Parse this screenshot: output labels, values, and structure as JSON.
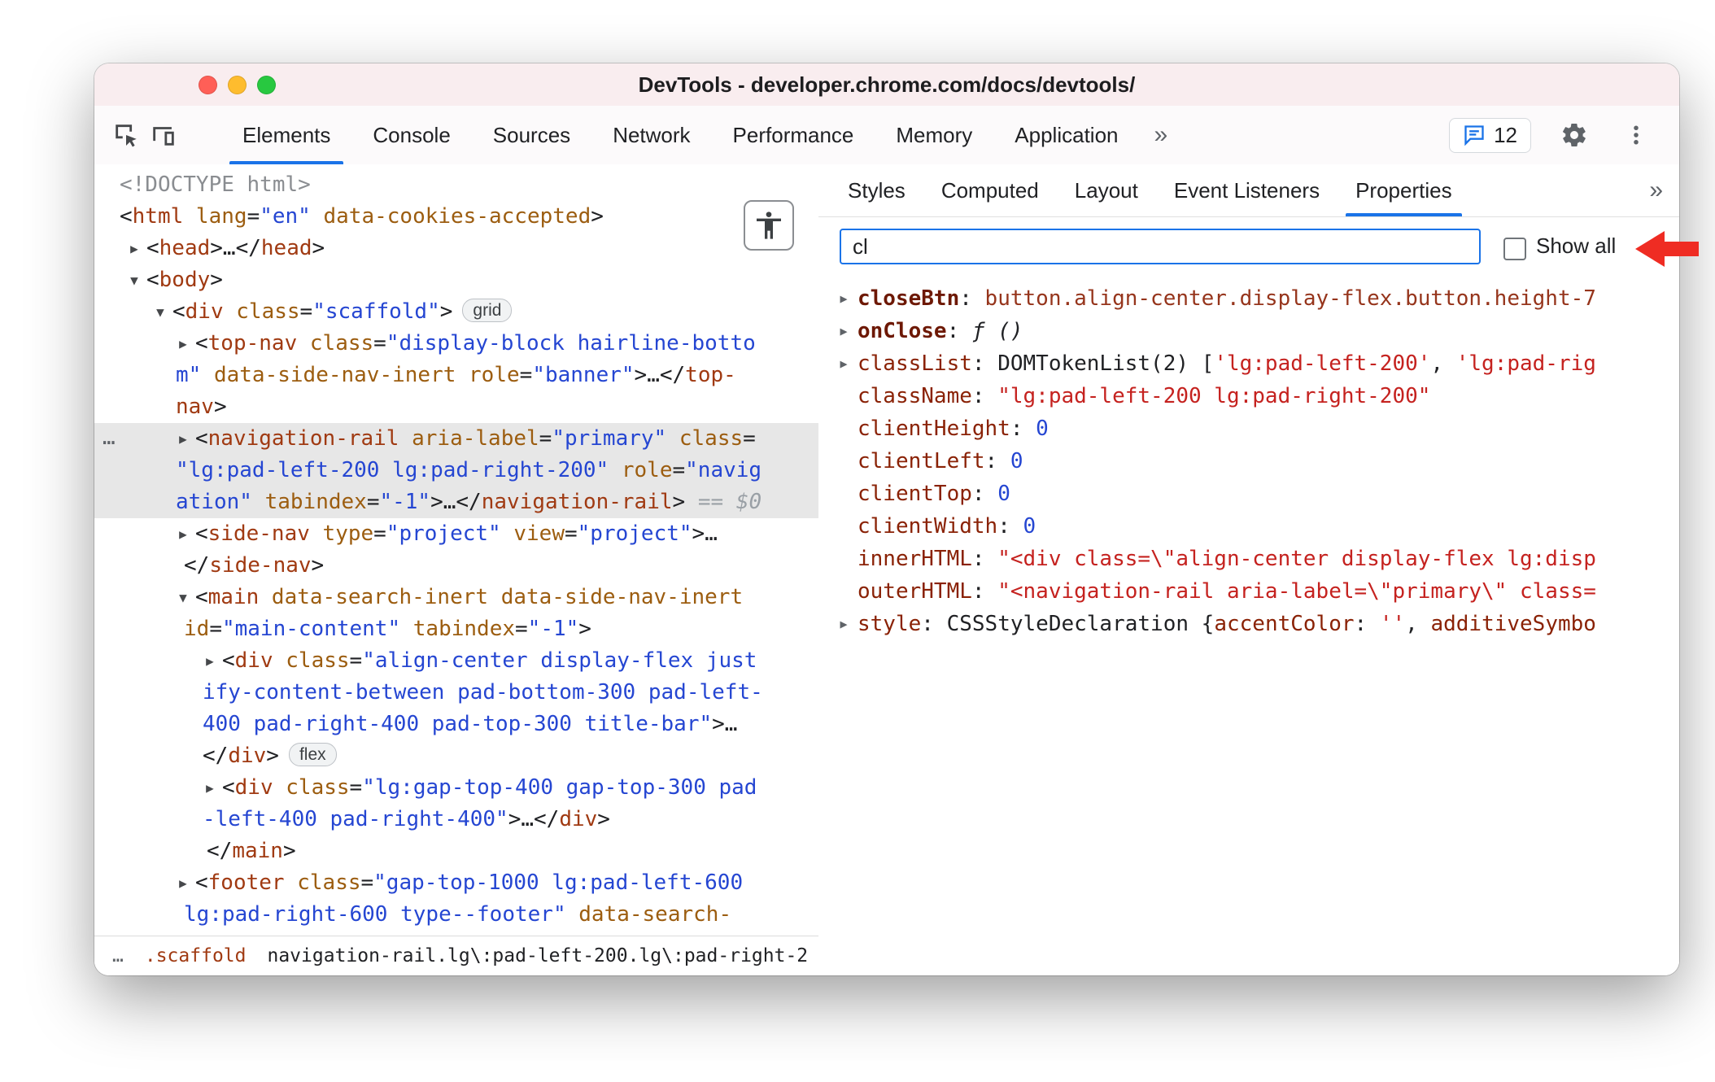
{
  "window": {
    "title": "DevTools - developer.chrome.com/docs/devtools/"
  },
  "colors": {
    "accent_blue": "#1a73e8",
    "selection_gray": "#e7e7e7",
    "annotation_red": "#ef2c23",
    "titlebar_pink": "#f9edef",
    "tag": "#a03a12",
    "attribute": "#9c5d10",
    "value_blue": "#2546d2",
    "string_red": "#c5221f"
  },
  "icons": {
    "inspect-icon": "cursor-in-box",
    "device-toolbar-icon": "devices",
    "issues-icon": "chat-bubble",
    "settings-icon": "gear",
    "menu-icon": "kebab-dots",
    "accessibility-icon": "person",
    "more-tabs-icon": "»",
    "collapsed-arrow-icon": "▶",
    "expanded-arrow-icon": "▼",
    "annotation-arrow-icon": "left-arrow"
  },
  "toolbar": {
    "tabs": [
      {
        "label": "Elements",
        "selected": true
      },
      {
        "label": "Console",
        "selected": false
      },
      {
        "label": "Sources",
        "selected": false
      },
      {
        "label": "Network",
        "selected": false
      },
      {
        "label": "Performance",
        "selected": false
      },
      {
        "label": "Memory",
        "selected": false
      },
      {
        "label": "Application",
        "selected": false
      }
    ],
    "more_label": "»",
    "issues_count": "12"
  },
  "elements_panel": {
    "dom_lines": [
      {
        "indent": 31,
        "marker": null,
        "selected": false,
        "segments": [
          [
            "gray",
            "<!DOCTYPE html>"
          ]
        ]
      },
      {
        "indent": 31,
        "marker": null,
        "selected": false,
        "segments": [
          [
            "punct",
            "<"
          ],
          [
            "tag",
            "html"
          ],
          [
            "attr",
            " lang"
          ],
          [
            "punct",
            "="
          ],
          [
            "str",
            "\"en\""
          ],
          [
            "attr",
            " data-cookies-accepted"
          ],
          [
            "punct",
            ">"
          ]
        ]
      },
      {
        "indent": 64,
        "marker": "closed",
        "selected": false,
        "segments": [
          [
            "punct",
            "<"
          ],
          [
            "tag",
            "head"
          ],
          [
            "punct",
            ">…</"
          ],
          [
            "tag",
            "head"
          ],
          [
            "punct",
            ">"
          ]
        ]
      },
      {
        "indent": 64,
        "marker": "open",
        "selected": false,
        "segments": [
          [
            "punct",
            "<"
          ],
          [
            "tag",
            "body"
          ],
          [
            "punct",
            ">"
          ]
        ]
      },
      {
        "indent": 96,
        "marker": "open",
        "selected": false,
        "badge": "grid",
        "segments": [
          [
            "punct",
            "<"
          ],
          [
            "tag",
            "div"
          ],
          [
            "attr",
            " class"
          ],
          [
            "punct",
            "="
          ],
          [
            "str",
            "\"scaffold\""
          ],
          [
            "punct",
            ">"
          ]
        ]
      },
      {
        "indent": 124,
        "marker": "closed",
        "selected": false,
        "segments": [
          [
            "punct",
            "<"
          ],
          [
            "tag",
            "top-nav"
          ],
          [
            "attr",
            " class"
          ],
          [
            "punct",
            "="
          ],
          [
            "str",
            "\"display-block hairline-botto"
          ]
        ]
      },
      {
        "indent": 100,
        "marker": null,
        "selected": false,
        "segments": [
          [
            "str",
            "m\""
          ],
          [
            "attr",
            " data-side-nav-inert role"
          ],
          [
            "punct",
            "="
          ],
          [
            "str",
            "\"banner\""
          ],
          [
            "punct",
            ">…</"
          ],
          [
            "tag",
            "top-"
          ]
        ]
      },
      {
        "indent": 100,
        "marker": null,
        "selected": false,
        "segments": [
          [
            "tag",
            "nav"
          ],
          [
            "punct",
            ">"
          ]
        ]
      },
      {
        "indent": 124,
        "marker": "closed",
        "selected": true,
        "gutter": "…",
        "segments": [
          [
            "punct",
            "<"
          ],
          [
            "tag",
            "navigation-rail"
          ],
          [
            "attr",
            " aria-label"
          ],
          [
            "punct",
            "="
          ],
          [
            "str",
            "\"primary\""
          ],
          [
            "attr",
            " class"
          ],
          [
            "punct",
            "="
          ]
        ]
      },
      {
        "indent": 100,
        "marker": null,
        "selected": true,
        "segments": [
          [
            "str",
            "\"lg:pad-left-200 lg:pad-right-200\""
          ],
          [
            "attr",
            " role"
          ],
          [
            "punct",
            "="
          ],
          [
            "str",
            "\"navig"
          ]
        ]
      },
      {
        "indent": 100,
        "marker": null,
        "selected": true,
        "segments": [
          [
            "str",
            "ation\""
          ],
          [
            "attr",
            " tabindex"
          ],
          [
            "punct",
            "="
          ],
          [
            "str",
            "\"-1\""
          ],
          [
            "punct",
            ">…</"
          ],
          [
            "tag",
            "navigation-rail"
          ],
          [
            "punct",
            ">"
          ],
          [
            "eq",
            " == "
          ],
          [
            "dollar",
            "$0"
          ]
        ]
      },
      {
        "indent": 124,
        "marker": "closed",
        "selected": false,
        "segments": [
          [
            "punct",
            "<"
          ],
          [
            "tag",
            "side-nav"
          ],
          [
            "attr",
            " type"
          ],
          [
            "punct",
            "="
          ],
          [
            "str",
            "\"project\""
          ],
          [
            "attr",
            " view"
          ],
          [
            "punct",
            "="
          ],
          [
            "str",
            "\"project\""
          ],
          [
            "punct",
            ">…"
          ]
        ]
      },
      {
        "indent": 110,
        "marker": null,
        "selected": false,
        "segments": [
          [
            "punct",
            "</"
          ],
          [
            "tag",
            "side-nav"
          ],
          [
            "punct",
            ">"
          ]
        ]
      },
      {
        "indent": 124,
        "marker": "open",
        "selected": false,
        "segments": [
          [
            "punct",
            "<"
          ],
          [
            "tag",
            "main"
          ],
          [
            "attr",
            " data-search-inert data-side-nav-inert"
          ]
        ]
      },
      {
        "indent": 110,
        "marker": null,
        "selected": false,
        "segments": [
          [
            "attr",
            "id"
          ],
          [
            "punct",
            "="
          ],
          [
            "str",
            "\"main-content\""
          ],
          [
            "attr",
            " tabindex"
          ],
          [
            "punct",
            "="
          ],
          [
            "str",
            "\"-1\""
          ],
          [
            "punct",
            ">"
          ]
        ]
      },
      {
        "indent": 157,
        "marker": "closed",
        "selected": false,
        "segments": [
          [
            "punct",
            "<"
          ],
          [
            "tag",
            "div"
          ],
          [
            "attr",
            " class"
          ],
          [
            "punct",
            "="
          ],
          [
            "str",
            "\"align-center display-flex just"
          ]
        ]
      },
      {
        "indent": 133,
        "marker": null,
        "selected": false,
        "segments": [
          [
            "str",
            "ify-content-between pad-bottom-300 pad-left-"
          ]
        ]
      },
      {
        "indent": 133,
        "marker": null,
        "selected": false,
        "segments": [
          [
            "str",
            "400 pad-right-400 pad-top-300 title-bar\""
          ],
          [
            "punct",
            ">…"
          ]
        ]
      },
      {
        "indent": 133,
        "marker": null,
        "selected": false,
        "badge": "flex",
        "segments": [
          [
            "punct",
            "</"
          ],
          [
            "tag",
            "div"
          ],
          [
            "punct",
            ">"
          ]
        ]
      },
      {
        "indent": 157,
        "marker": "closed",
        "selected": false,
        "segments": [
          [
            "punct",
            "<"
          ],
          [
            "tag",
            "div"
          ],
          [
            "attr",
            " class"
          ],
          [
            "punct",
            "="
          ],
          [
            "str",
            "\"lg:gap-top-400 gap-top-300 pad"
          ]
        ]
      },
      {
        "indent": 133,
        "marker": null,
        "selected": false,
        "segments": [
          [
            "str",
            "-left-400 pad-right-400\""
          ],
          [
            "punct",
            ">…</"
          ],
          [
            "tag",
            "div"
          ],
          [
            "punct",
            ">"
          ]
        ]
      },
      {
        "indent": 138,
        "marker": null,
        "selected": false,
        "segments": [
          [
            "punct",
            "</"
          ],
          [
            "tag",
            "main"
          ],
          [
            "punct",
            ">"
          ]
        ]
      },
      {
        "indent": 124,
        "marker": "closed",
        "selected": false,
        "segments": [
          [
            "punct",
            "<"
          ],
          [
            "tag",
            "footer"
          ],
          [
            "attr",
            " class"
          ],
          [
            "punct",
            "="
          ],
          [
            "str",
            "\"gap-top-1000 lg:pad-left-600"
          ]
        ]
      },
      {
        "indent": 110,
        "marker": null,
        "selected": false,
        "segments": [
          [
            "str",
            "lg:pad-right-600 type--footer\""
          ],
          [
            "attr",
            " data-search-"
          ]
        ]
      }
    ],
    "breadcrumbs": [
      {
        "text": "…",
        "kind": "dim"
      },
      {
        "text": ".scaffold",
        "kind": "accent"
      },
      {
        "text": "navigation-rail.lg\\:pad-left-200.lg\\:pad-right-2",
        "kind": "dark"
      },
      {
        "text": "…",
        "kind": "dim"
      }
    ]
  },
  "sidebar": {
    "tabs": [
      {
        "label": "Styles",
        "selected": false
      },
      {
        "label": "Computed",
        "selected": false
      },
      {
        "label": "Layout",
        "selected": false
      },
      {
        "label": "Event Listeners",
        "selected": false
      },
      {
        "label": "Properties",
        "selected": true
      }
    ],
    "more_label": "»",
    "filter": {
      "value": "cl",
      "show_all_label": "Show all",
      "show_all_checked": false
    },
    "properties": [
      {
        "expandable": true,
        "own": true,
        "name": "closeBtn",
        "value": [
          [
            "node",
            "button.align-center.display-flex.button.height-7"
          ]
        ]
      },
      {
        "expandable": true,
        "own": true,
        "name": "onClose",
        "value": [
          [
            "fn",
            "ƒ ()"
          ]
        ]
      },
      {
        "expandable": true,
        "own": false,
        "name": "classList",
        "value": [
          [
            "plain",
            "DOMTokenList(2) ["
          ],
          [
            "red",
            "'lg:pad-left-200'"
          ],
          [
            "plain",
            ", "
          ],
          [
            "red",
            "'lg:pad-rig"
          ]
        ]
      },
      {
        "expandable": false,
        "own": false,
        "name": "className",
        "value": [
          [
            "red",
            "\"lg:pad-left-200 lg:pad-right-200\""
          ]
        ]
      },
      {
        "expandable": false,
        "own": false,
        "name": "clientHeight",
        "value": [
          [
            "num",
            "0"
          ]
        ]
      },
      {
        "expandable": false,
        "own": false,
        "name": "clientLeft",
        "value": [
          [
            "num",
            "0"
          ]
        ]
      },
      {
        "expandable": false,
        "own": false,
        "name": "clientTop",
        "value": [
          [
            "num",
            "0"
          ]
        ]
      },
      {
        "expandable": false,
        "own": false,
        "name": "clientWidth",
        "value": [
          [
            "num",
            "0"
          ]
        ]
      },
      {
        "expandable": false,
        "own": false,
        "name": "innerHTML",
        "value": [
          [
            "red",
            "\"<div class=\\\"align-center display-flex lg:disp"
          ]
        ]
      },
      {
        "expandable": false,
        "own": false,
        "name": "outerHTML",
        "value": [
          [
            "red",
            "\"<navigation-rail aria-label=\\\"primary\\\" class="
          ]
        ]
      },
      {
        "expandable": true,
        "own": false,
        "name": "style",
        "value": [
          [
            "plain",
            "CSSStyleDeclaration {"
          ],
          [
            "pname",
            "accentColor"
          ],
          [
            "plain",
            ": "
          ],
          [
            "red",
            "''"
          ],
          [
            "plain",
            ", "
          ],
          [
            "pname",
            "additiveSymbo"
          ]
        ]
      }
    ]
  }
}
